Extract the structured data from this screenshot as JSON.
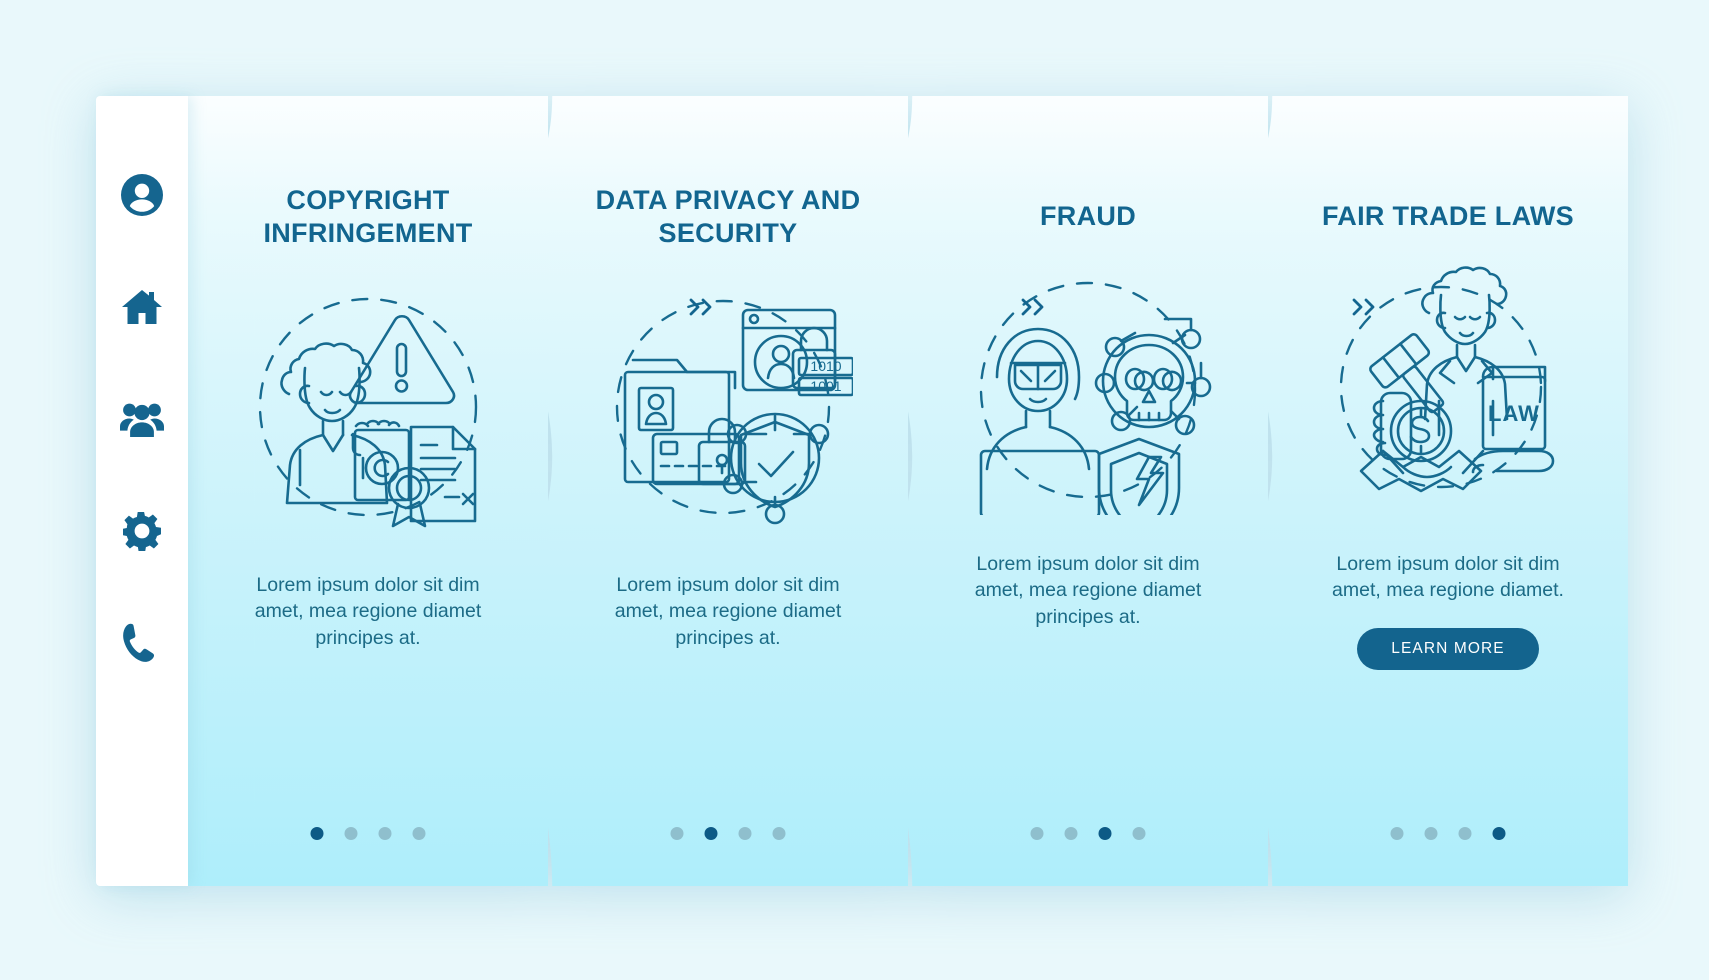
{
  "theme": {
    "page_bg": "#e9f8fb",
    "accent_dark": "#13648e",
    "title_color": "#12658f",
    "body_color": "#1c6b86",
    "dot_inactive": "#8fbfcd",
    "dot_active": "#0d5a86",
    "card_gradient_top": "#fbfeff",
    "card_gradient_bottom": "#aeeefb",
    "sidebar_bg": "#ffffff"
  },
  "sidebar": {
    "items": [
      {
        "icon": "user-circle-icon",
        "label": "Profile"
      },
      {
        "icon": "home-icon",
        "label": "Home"
      },
      {
        "icon": "people-group-icon",
        "label": "Team"
      },
      {
        "icon": "gear-icon",
        "label": "Settings"
      },
      {
        "icon": "phone-icon",
        "label": "Contact"
      }
    ]
  },
  "separators": [
    {
      "icon": "double-chevron-right-icon",
      "glyph": "»"
    },
    {
      "icon": "double-chevron-right-icon",
      "glyph": "»"
    },
    {
      "icon": "double-chevron-right-icon",
      "glyph": "»"
    }
  ],
  "cards": [
    {
      "title": "COPYRIGHT INFRINGEMENT",
      "illustration": "copyright-infringement-illustration",
      "body": "Lorem ipsum dolor sit dim amet, mea regione diamet principes at.",
      "has_button": false,
      "button_label": "",
      "dots": {
        "count": 4,
        "active_index": 0
      }
    },
    {
      "title": "DATA PRIVACY AND SECURITY",
      "illustration": "data-privacy-security-illustration",
      "illustration_text": [
        "1010",
        "1001"
      ],
      "body": "Lorem ipsum dolor sit dim amet, mea regione diamet principes at.",
      "has_button": false,
      "button_label": "",
      "dots": {
        "count": 4,
        "active_index": 1
      }
    },
    {
      "title": "FRAUD",
      "illustration": "fraud-illustration",
      "body": "Lorem ipsum dolor sit dim amet, mea regione diamet principes at.",
      "has_button": false,
      "button_label": "",
      "dots": {
        "count": 4,
        "active_index": 2
      }
    },
    {
      "title": "FAIR TRADE LAWS",
      "illustration": "fair-trade-laws-illustration",
      "illustration_text": [
        "LAW"
      ],
      "body": "Lorem ipsum dolor sit dim amet, mea regione diamet.",
      "has_button": true,
      "button_label": "LEARN MORE",
      "dots": {
        "count": 4,
        "active_index": 3
      }
    }
  ]
}
